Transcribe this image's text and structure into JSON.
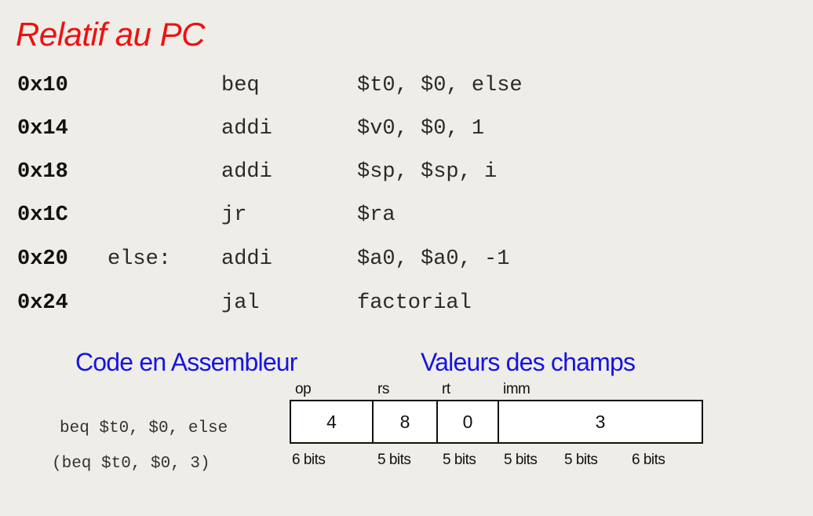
{
  "title": "Relatif au PC",
  "code": [
    {
      "addr": "0x10",
      "label": "",
      "op": "beq",
      "args": "$t0, $0, else"
    },
    {
      "addr": "0x14",
      "label": "",
      "op": "addi",
      "args": "$v0, $0, 1"
    },
    {
      "addr": "0x18",
      "label": "",
      "op": "addi",
      "args": "$sp, $sp, i"
    },
    {
      "addr": "0x1C",
      "label": "",
      "op": "jr",
      "args": "$ra"
    },
    {
      "addr": "0x20",
      "label": "else:",
      "op": "addi",
      "args": "$a0, $a0, -1"
    },
    {
      "addr": "0x24",
      "label": "",
      "op": "jal",
      "args": "factorial"
    }
  ],
  "headings": {
    "assembly": "Code en Assembleur",
    "fields": "Valeurs des champs"
  },
  "assembly_example": {
    "line1": "beq $t0, $0, else",
    "line2": "(beq $t0, $0, 3)"
  },
  "field_names": [
    "op",
    "rs",
    "rt",
    "imm"
  ],
  "field_values": [
    "4",
    "8",
    "0",
    "3"
  ],
  "bit_widths": [
    "6 bits",
    "5 bits",
    "5 bits",
    "5 bits",
    "5 bits",
    "6 bits"
  ],
  "colors": {
    "title": "#ee1111",
    "heading": "#1515e0",
    "background": "#efede7"
  }
}
